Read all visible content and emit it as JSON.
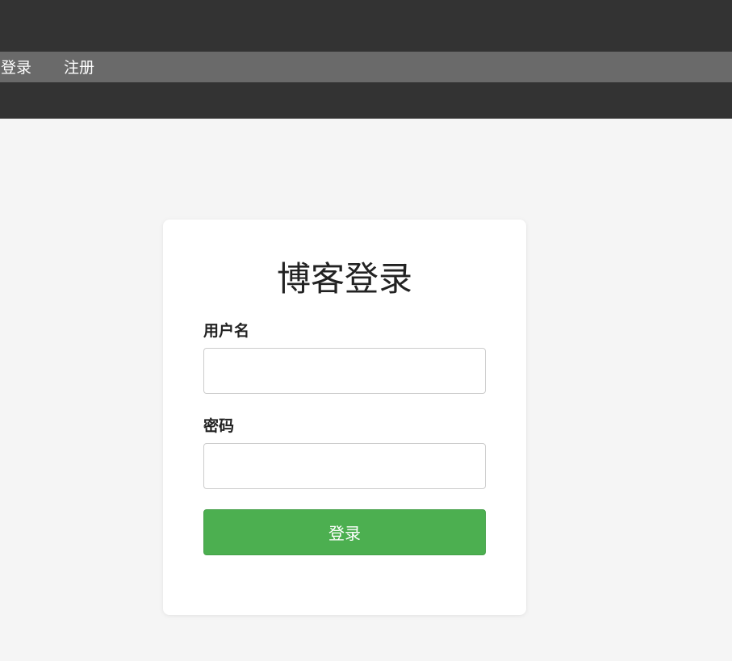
{
  "nav": {
    "items": [
      {
        "label": "登录"
      },
      {
        "label": "注册"
      }
    ]
  },
  "form": {
    "title": "博客登录",
    "username_label": "用户名",
    "username_value": "",
    "password_label": "密码",
    "password_value": "",
    "submit_label": "登录"
  },
  "colors": {
    "header_bg": "#333333",
    "nav_bg": "#6a6a6a",
    "page_bg": "#f5f5f5",
    "button_bg": "#4caf50"
  }
}
